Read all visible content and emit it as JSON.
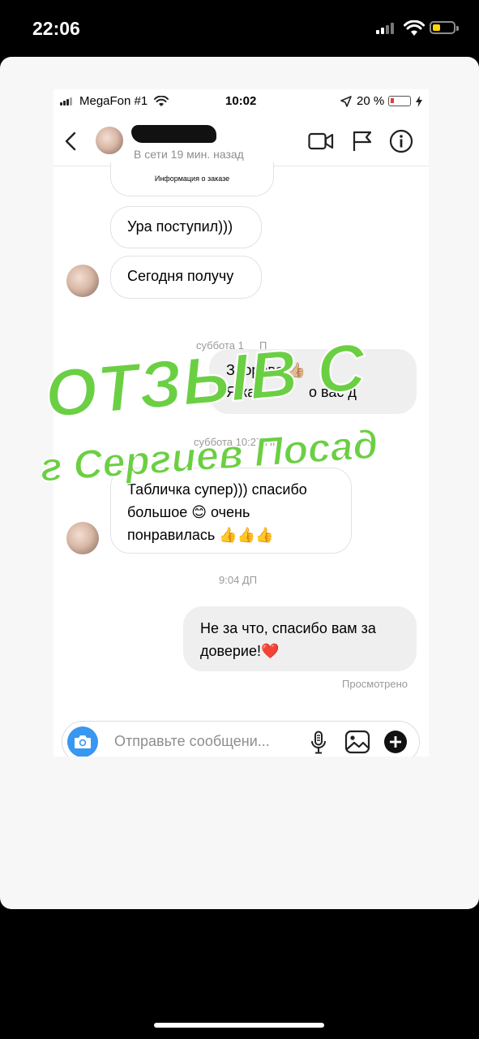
{
  "outer_status": {
    "time": "22:06"
  },
  "inner_status": {
    "carrier": "MegaFon #1",
    "time": "10:02",
    "battery": "20 %"
  },
  "header": {
    "subtitle": "В сети 19 мин. назад"
  },
  "messages": {
    "order_info": "Информация о заказе",
    "m1": "Ура поступил)))",
    "m2": "Сегодня получу",
    "ts1": "суббота 1",
    "ts1_tail": "П",
    "m3_line1": "Здорово 👍🏼",
    "m3_line2": "Я как",
    "m3_line2_tail": "о вас д",
    "ts2": "суббота 10:27 ПП",
    "m4_line1": "Табличка супер))) спасибо",
    "m4_line2": "большое 😊 очень",
    "m4_line3": "понравилась 👍👍👍",
    "ts3": "9:04 ДП",
    "m5_line1": "Не за что, спасибо вам за",
    "m5_line2": "доверие!❤️",
    "seen": "Просмотрено"
  },
  "input": {
    "placeholder": "Отправьте сообщени..."
  },
  "overlay": {
    "line1": "ОТЗЫВ С",
    "line2": "г Сергиев Посад"
  },
  "colors": {
    "overlay_green": "#6bcf43",
    "camera_blue": "#3897f0"
  },
  "icons": [
    "signal-icon",
    "wifi-icon",
    "battery-icon",
    "back-icon",
    "video-call-icon",
    "flag-icon",
    "info-icon",
    "camera-icon",
    "microphone-icon",
    "gallery-icon",
    "plus-icon"
  ]
}
